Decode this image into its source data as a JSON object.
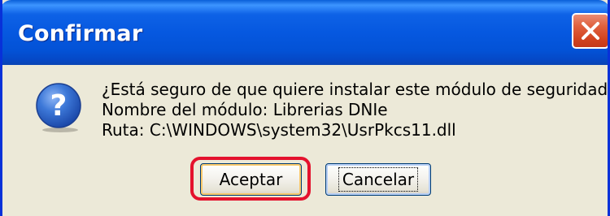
{
  "dialog": {
    "title": "Confirmar",
    "icon": "question-icon",
    "message_lines": [
      "¿Está seguro de que quiere instalar este módulo de seguridad?",
      "Nombre del módulo: Librerias DNIe",
      "Ruta: C:\\WINDOWS\\system32\\UsrPkcs11.dll"
    ],
    "buttons": {
      "accept_label": "Aceptar",
      "cancel_label": "Cancelar"
    }
  },
  "colors": {
    "titlebar": "#0658e0",
    "window_border": "#0831d9",
    "body": "#ece9d8",
    "close_button": "#d2431f",
    "highlight": "#e4122d",
    "question_icon": "#2f66c8"
  }
}
